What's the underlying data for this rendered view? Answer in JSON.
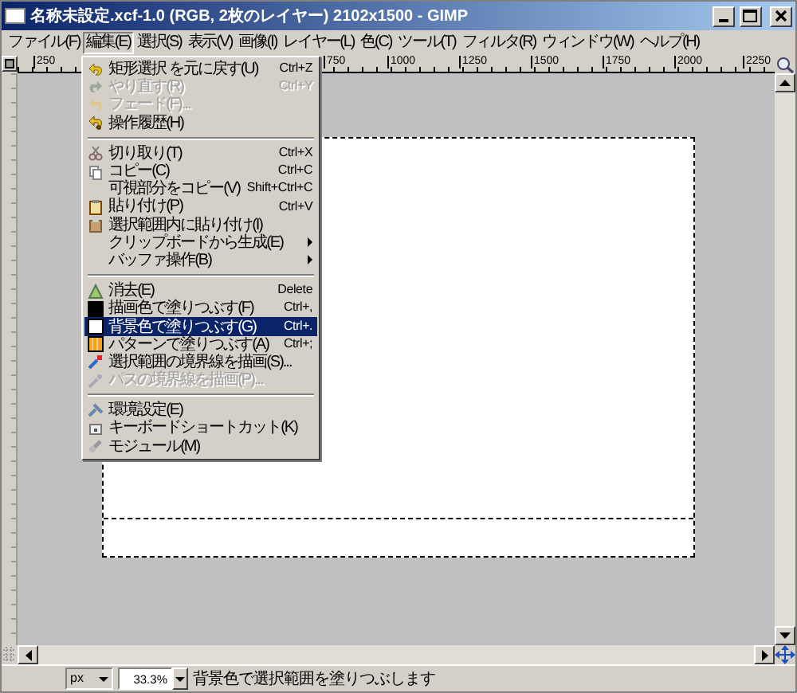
{
  "window": {
    "title": "名称未設定.xcf-1.0 (RGB, 2枚のレイヤー) 2102x1500 - GIMP"
  },
  "menubar": [
    {
      "label": "ファイル(F)",
      "selected": false
    },
    {
      "label": "編集(E)",
      "selected": true
    },
    {
      "label": "選択(S)",
      "selected": false
    },
    {
      "label": "表示(V)",
      "selected": false
    },
    {
      "label": "画像(I)",
      "selected": false
    },
    {
      "label": "レイヤー(L)",
      "selected": false
    },
    {
      "label": "色(C)",
      "selected": false
    },
    {
      "label": "ツール(T)",
      "selected": false
    },
    {
      "label": "フィルタ(R)",
      "selected": false
    },
    {
      "label": "ウィンドウ(W)",
      "selected": false
    },
    {
      "label": "ヘルプ(H)",
      "selected": false
    }
  ],
  "edit_menu": {
    "groups": [
      [
        {
          "label": "矩形選択 を元に戻す(U)",
          "shortcut": "Ctrl+Z",
          "disabled": false,
          "selected": false,
          "submenu": false
        },
        {
          "label": "やり直す(R)",
          "shortcut": "Ctrl+Y",
          "disabled": true,
          "selected": false,
          "submenu": false
        },
        {
          "label": "フェード(F)...",
          "disabled": true,
          "selected": false,
          "submenu": false
        },
        {
          "label": "操作履歴(H)",
          "disabled": false,
          "selected": false,
          "submenu": false
        }
      ],
      [
        {
          "label": "切り取り(T)",
          "shortcut": "Ctrl+X",
          "disabled": false,
          "selected": false,
          "submenu": false
        },
        {
          "label": "コピー(C)",
          "shortcut": "Ctrl+C",
          "disabled": false,
          "selected": false,
          "submenu": false
        },
        {
          "label": "可視部分をコピー(V)",
          "shortcut": "Shift+Ctrl+C",
          "disabled": false,
          "selected": false,
          "submenu": false
        },
        {
          "label": "貼り付け(P)",
          "shortcut": "Ctrl+V",
          "disabled": false,
          "selected": false,
          "submenu": false
        },
        {
          "label": "選択範囲内に貼り付け(I)",
          "disabled": false,
          "selected": false,
          "submenu": false
        },
        {
          "label": "クリップボードから生成(E)",
          "disabled": false,
          "selected": false,
          "submenu": true
        },
        {
          "label": "バッファ操作(B)",
          "disabled": false,
          "selected": false,
          "submenu": true
        }
      ],
      [
        {
          "label": "消去(E)",
          "shortcut": "Delete",
          "disabled": false,
          "selected": false,
          "submenu": false
        },
        {
          "label": "描画色で塗りつぶす(F)",
          "shortcut": "Ctrl+,",
          "disabled": false,
          "selected": false,
          "submenu": false
        },
        {
          "label": "背景色で塗りつぶす(G)",
          "shortcut": "Ctrl+.",
          "disabled": false,
          "selected": true,
          "submenu": false
        },
        {
          "label": "パターンで塗りつぶす(A)",
          "shortcut": "Ctrl+;",
          "disabled": false,
          "selected": false,
          "submenu": false
        },
        {
          "label": "選択範囲の境界線を描画(S)...",
          "disabled": false,
          "selected": false,
          "submenu": false
        },
        {
          "label": "パスの境界線を描画(P)...",
          "disabled": true,
          "selected": false,
          "submenu": false
        }
      ],
      [
        {
          "label": "環境設定(E)",
          "disabled": false,
          "selected": false,
          "submenu": false
        },
        {
          "label": "キーボードショートカット(K)",
          "disabled": false,
          "selected": false,
          "submenu": false
        },
        {
          "label": "モジュール(M)",
          "disabled": false,
          "selected": false,
          "submenu": false
        }
      ]
    ]
  },
  "ruler": {
    "labels": [
      "250",
      "750",
      "1000",
      "1250",
      "1500",
      "1750",
      "2000",
      "2250"
    ]
  },
  "status_bar": {
    "unit": "px",
    "zoom": "33.3%",
    "message": "背景色で選択範囲を塗りつぶします"
  }
}
